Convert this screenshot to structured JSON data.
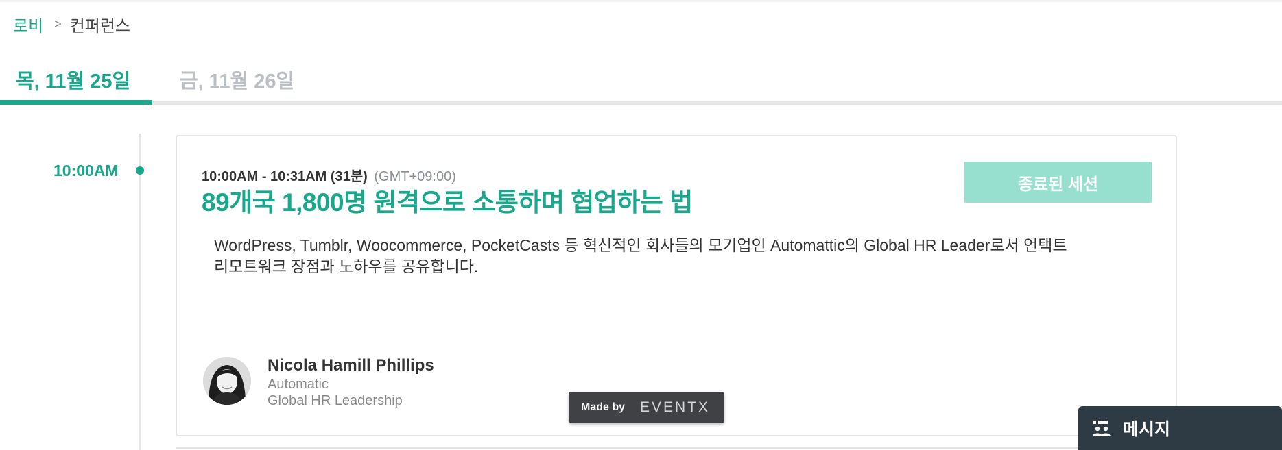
{
  "breadcrumb": {
    "lobby": "로비",
    "separator": ">",
    "current": "컨퍼런스"
  },
  "tabs": [
    {
      "label": "목, 11월 25일",
      "active": true
    },
    {
      "label": "금, 11월 26일",
      "active": false
    }
  ],
  "timeline": {
    "time": "10:00AM"
  },
  "session": {
    "time_range": "10:00AM - 10:31AM (31분)",
    "timezone": "(GMT+09:00)",
    "title": "89개국 1,800명 원격으로 소통하며 협업하는 법",
    "status_button": "종료된 세션",
    "description_line1": "WordPress, Tumblr, Woocommerce, PocketCasts 등 혁신적인 회사들의 모기업인 Automattic의 Global HR Leader로서 언택트",
    "description_line2": "리모트워크 장점과 노하우를 공유합니다.",
    "speaker": {
      "name": "Nicola Hamill Phillips",
      "company": "Automatic",
      "role": "Global HR Leadership"
    }
  },
  "badge": {
    "made_by": "Made by",
    "brand": "EVENTX"
  },
  "message_widget": {
    "label": "메시지",
    "icon": "people-chat-icon"
  },
  "colors": {
    "accent": "#1aa88d",
    "button_disabled": "#97e0d0",
    "widget_bg": "#2e3a44"
  }
}
